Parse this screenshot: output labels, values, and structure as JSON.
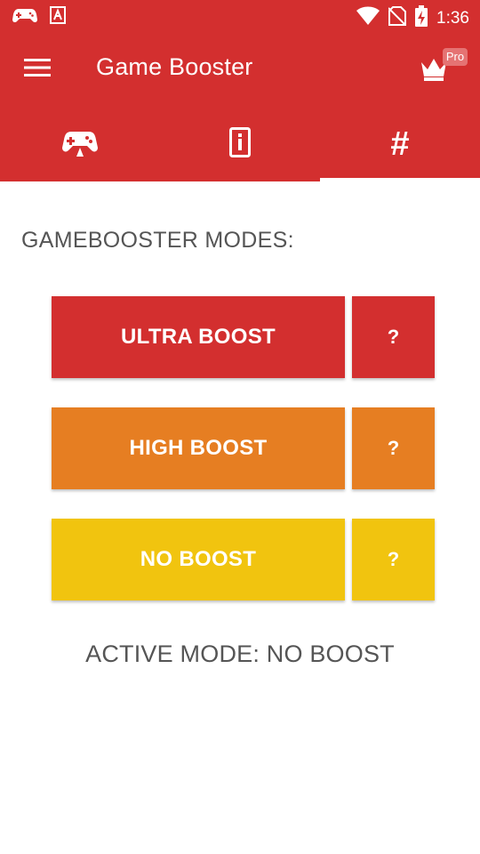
{
  "status_bar": {
    "time": "1:36",
    "left_icons": [
      "gamepad-icon",
      "app-notification-icon"
    ],
    "right_icons": [
      "wifi-icon",
      "no-sim-icon",
      "battery-charging-icon"
    ]
  },
  "app_bar": {
    "title": "Game Booster",
    "menu_icon": "hamburger-menu-icon",
    "pro_badge": "Pro"
  },
  "tabs": [
    {
      "icon": "gamepad-icon",
      "active": false
    },
    {
      "icon": "phone-info-icon",
      "active": false
    },
    {
      "icon": "hash-icon",
      "label": "#",
      "active": true
    }
  ],
  "content": {
    "section_title": "GAMEBOOSTER MODES:",
    "modes": [
      {
        "label": "ULTRA BOOST",
        "help": "?",
        "color": "#d32f2f"
      },
      {
        "label": "HIGH BOOST",
        "help": "?",
        "color": "#e67e22"
      },
      {
        "label": "NO BOOST",
        "help": "?",
        "color": "#f1c40f"
      }
    ],
    "active_mode": "ACTIVE MODE: NO BOOST"
  },
  "colors": {
    "primary": "#d32f2f",
    "text_secondary": "#555555"
  }
}
